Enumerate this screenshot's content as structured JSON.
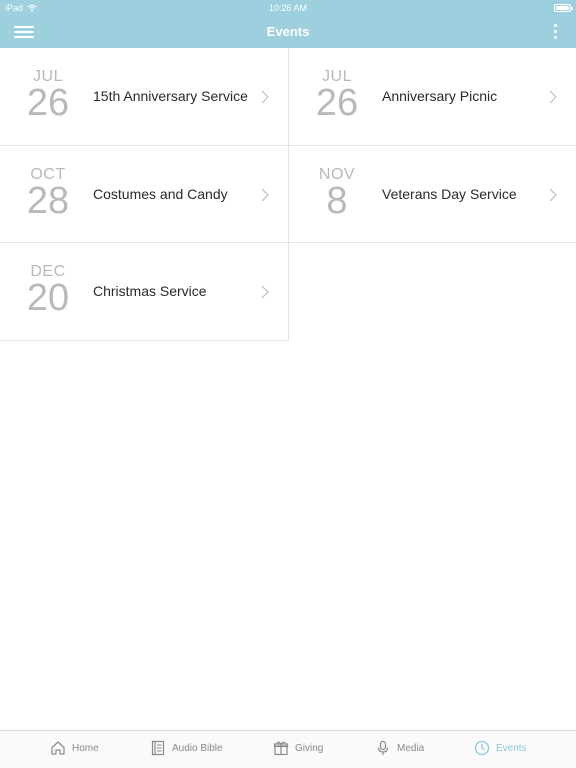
{
  "status_bar": {
    "device": "iPad",
    "time": "10:26 AM"
  },
  "nav": {
    "title": "Events"
  },
  "events": [
    {
      "month": "JUL",
      "day": "26",
      "title": "15th Anniversary Service"
    },
    {
      "month": "JUL",
      "day": "26",
      "title": "Anniversary Picnic"
    },
    {
      "month": "OCT",
      "day": "28",
      "title": "Costumes and Candy"
    },
    {
      "month": "NOV",
      "day": "8",
      "title": "Veterans Day Service"
    },
    {
      "month": "DEC",
      "day": "20",
      "title": "Christmas Service"
    }
  ],
  "tabs": [
    {
      "label": "Home",
      "icon": "home-icon",
      "active": false
    },
    {
      "label": "Audio Bible",
      "icon": "book-icon",
      "active": false
    },
    {
      "label": "Giving",
      "icon": "gift-icon",
      "active": false
    },
    {
      "label": "Media",
      "icon": "microphone-icon",
      "active": false
    },
    {
      "label": "Events",
      "icon": "clock-icon",
      "active": true
    }
  ],
  "colors": {
    "header": "#9ecfdf",
    "active_tab": "#8ec8dc",
    "date_text": "#b9b9b9"
  }
}
